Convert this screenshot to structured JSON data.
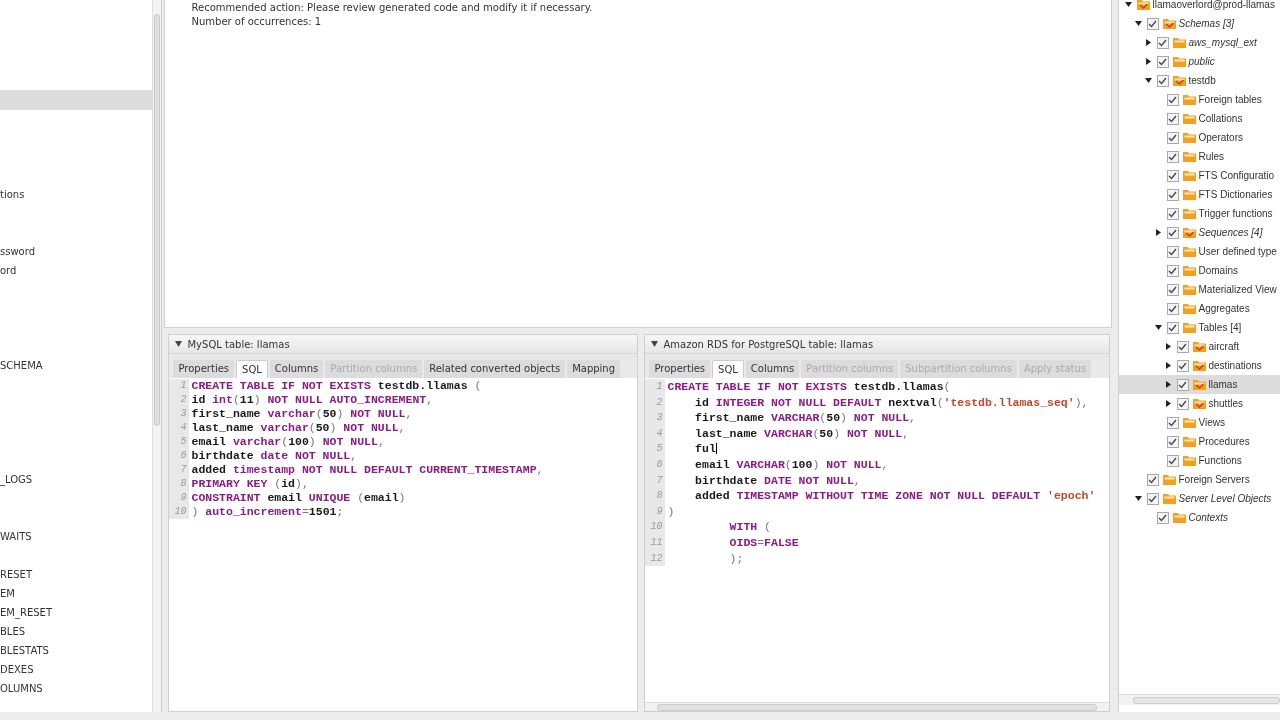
{
  "left_panel": {
    "items": [
      {
        "label": "tions"
      },
      {
        "label": "ssword"
      },
      {
        "label": "ord"
      },
      {
        "label": "SCHEMA"
      },
      {
        "label": "_LOGS"
      },
      {
        "label": "WAITS"
      },
      {
        "label": "RESET"
      },
      {
        "label": "EM"
      },
      {
        "label": "EM_RESET"
      },
      {
        "label": "BLES"
      },
      {
        "label": "BLESTATS"
      },
      {
        "label": "DEXES"
      },
      {
        "label": "OLUMNS"
      }
    ]
  },
  "message": {
    "lines": [
      "Recommended action: Please review generated code and modify it if necessary.",
      "Number of occurrences: 1"
    ]
  },
  "panes": [
    {
      "title": "MySQL table: llamas",
      "expanded": true,
      "tabs": [
        {
          "label": "Properties",
          "selected": false,
          "disabled": false
        },
        {
          "label": "SQL",
          "selected": true,
          "disabled": false
        },
        {
          "label": "Columns",
          "selected": false,
          "disabled": false
        },
        {
          "label": "Partition columns",
          "selected": false,
          "disabled": true
        },
        {
          "label": "Related converted objects",
          "selected": false,
          "disabled": false
        },
        {
          "label": "Mapping",
          "selected": false,
          "disabled": false
        }
      ],
      "lines": [
        {
          "num": "1",
          "caret": false,
          "tokens": [
            {
              "kind": "kw",
              "text": "CREATE TABLE IF NOT EXISTS "
            },
            {
              "kind": "id",
              "text": "testdb.llamas "
            },
            {
              "kind": "p",
              "text": "("
            }
          ]
        },
        {
          "num": "2",
          "caret": false,
          "tokens": [
            {
              "kind": "id",
              "text": "id "
            },
            {
              "kind": "kw",
              "text": "int"
            },
            {
              "kind": "p",
              "text": "("
            },
            {
              "kind": "id",
              "text": "11"
            },
            {
              "kind": "p",
              "text": ") "
            },
            {
              "kind": "kw",
              "text": "NOT NULL AUTO_INCREMENT"
            },
            {
              "kind": "p",
              "text": ","
            }
          ]
        },
        {
          "num": "3",
          "caret": false,
          "tokens": [
            {
              "kind": "id",
              "text": "first_name "
            },
            {
              "kind": "kw",
              "text": "varchar"
            },
            {
              "kind": "p",
              "text": "("
            },
            {
              "kind": "id",
              "text": "50"
            },
            {
              "kind": "p",
              "text": ") "
            },
            {
              "kind": "kw",
              "text": "NOT NULL"
            },
            {
              "kind": "p",
              "text": ","
            }
          ]
        },
        {
          "num": "4",
          "caret": false,
          "tokens": [
            {
              "kind": "id",
              "text": "last_name "
            },
            {
              "kind": "kw",
              "text": "varchar"
            },
            {
              "kind": "p",
              "text": "("
            },
            {
              "kind": "id",
              "text": "50"
            },
            {
              "kind": "p",
              "text": ") "
            },
            {
              "kind": "kw",
              "text": "NOT NULL"
            },
            {
              "kind": "p",
              "text": ","
            }
          ]
        },
        {
          "num": "5",
          "caret": false,
          "tokens": [
            {
              "kind": "id",
              "text": "email "
            },
            {
              "kind": "kw",
              "text": "varchar"
            },
            {
              "kind": "p",
              "text": "("
            },
            {
              "kind": "id",
              "text": "100"
            },
            {
              "kind": "p",
              "text": ") "
            },
            {
              "kind": "kw",
              "text": "NOT NULL"
            },
            {
              "kind": "p",
              "text": ","
            }
          ]
        },
        {
          "num": "6",
          "caret": false,
          "tokens": [
            {
              "kind": "id",
              "text": "birthdate "
            },
            {
              "kind": "kw",
              "text": "date NOT NULL"
            },
            {
              "kind": "p",
              "text": ","
            }
          ]
        },
        {
          "num": "7",
          "caret": false,
          "tokens": [
            {
              "kind": "id",
              "text": "added "
            },
            {
              "kind": "kw",
              "text": "timestamp NOT NULL DEFAULT CURRENT_TIMESTAMP"
            },
            {
              "kind": "p",
              "text": ","
            }
          ]
        },
        {
          "num": "8",
          "caret": false,
          "tokens": [
            {
              "kind": "kw",
              "text": "PRIMARY KEY "
            },
            {
              "kind": "p",
              "text": "("
            },
            {
              "kind": "id",
              "text": "id"
            },
            {
              "kind": "p",
              "text": "),"
            }
          ]
        },
        {
          "num": "9",
          "caret": false,
          "tokens": [
            {
              "kind": "kw",
              "text": "CONSTRAINT "
            },
            {
              "kind": "id",
              "text": "email "
            },
            {
              "kind": "kw",
              "text": "UNIQUE "
            },
            {
              "kind": "p",
              "text": "("
            },
            {
              "kind": "id",
              "text": "email"
            },
            {
              "kind": "p",
              "text": ")"
            }
          ]
        },
        {
          "num": "10",
          "caret": false,
          "tokens": [
            {
              "kind": "p",
              "text": ") "
            },
            {
              "kind": "kw",
              "text": "auto_increment"
            },
            {
              "kind": "p",
              "text": "="
            },
            {
              "kind": "id",
              "text": "1501"
            },
            {
              "kind": "p",
              "text": ";"
            }
          ]
        }
      ]
    },
    {
      "title": "Amazon RDS for PostgreSQL table: llamas",
      "expanded": true,
      "tabs": [
        {
          "label": "Properties",
          "selected": false,
          "disabled": false
        },
        {
          "label": "SQL",
          "selected": true,
          "disabled": false
        },
        {
          "label": "Columns",
          "selected": false,
          "disabled": false
        },
        {
          "label": "Partition columns",
          "selected": false,
          "disabled": true
        },
        {
          "label": "Subpartition columns",
          "selected": false,
          "disabled": true
        },
        {
          "label": "Apply status",
          "selected": false,
          "disabled": true
        }
      ],
      "lines": [
        {
          "num": "1",
          "caret": false,
          "tokens": [
            {
              "kind": "kw",
              "text": "CREATE TABLE IF NOT EXISTS "
            },
            {
              "kind": "id",
              "text": "testdb.llamas"
            },
            {
              "kind": "p",
              "text": "("
            }
          ]
        },
        {
          "num": "2",
          "caret": false,
          "tokens": [
            {
              "kind": "id",
              "text": "    id "
            },
            {
              "kind": "kw",
              "text": "INTEGER NOT NULL DEFAULT "
            },
            {
              "kind": "id",
              "text": "nextval"
            },
            {
              "kind": "p",
              "text": "("
            },
            {
              "kind": "str",
              "text": "'testdb.llamas_seq'"
            },
            {
              "kind": "p",
              "text": "),"
            }
          ]
        },
        {
          "num": "3",
          "caret": false,
          "tokens": [
            {
              "kind": "id",
              "text": "    first_name "
            },
            {
              "kind": "kw",
              "text": "VARCHAR"
            },
            {
              "kind": "p",
              "text": "("
            },
            {
              "kind": "id",
              "text": "50"
            },
            {
              "kind": "p",
              "text": ") "
            },
            {
              "kind": "kw",
              "text": "NOT NULL"
            },
            {
              "kind": "p",
              "text": ","
            }
          ]
        },
        {
          "num": "4",
          "caret": false,
          "tokens": [
            {
              "kind": "id",
              "text": "    last_name "
            },
            {
              "kind": "kw",
              "text": "VARCHAR"
            },
            {
              "kind": "p",
              "text": "("
            },
            {
              "kind": "id",
              "text": "50"
            },
            {
              "kind": "p",
              "text": ") "
            },
            {
              "kind": "kw",
              "text": "NOT NULL"
            },
            {
              "kind": "p",
              "text": ","
            }
          ]
        },
        {
          "num": "5",
          "caret": true,
          "tokens": [
            {
              "kind": "id",
              "text": "    ful"
            }
          ]
        },
        {
          "num": "6",
          "caret": false,
          "tokens": [
            {
              "kind": "id",
              "text": "    email "
            },
            {
              "kind": "kw",
              "text": "VARCHAR"
            },
            {
              "kind": "p",
              "text": "("
            },
            {
              "kind": "id",
              "text": "100"
            },
            {
              "kind": "p",
              "text": ") "
            },
            {
              "kind": "kw",
              "text": "NOT NULL"
            },
            {
              "kind": "p",
              "text": ","
            }
          ]
        },
        {
          "num": "7",
          "caret": false,
          "tokens": [
            {
              "kind": "id",
              "text": "    birthdate "
            },
            {
              "kind": "kw",
              "text": "DATE NOT NULL"
            },
            {
              "kind": "p",
              "text": ","
            }
          ]
        },
        {
          "num": "8",
          "caret": false,
          "tokens": [
            {
              "kind": "id",
              "text": "    added "
            },
            {
              "kind": "kw",
              "text": "TIMESTAMP WITHOUT TIME ZONE NOT NULL DEFAULT "
            },
            {
              "kind": "str",
              "text": "'epoch'"
            }
          ]
        },
        {
          "num": "9",
          "caret": false,
          "tokens": [
            {
              "kind": "p",
              "text": ")"
            }
          ]
        },
        {
          "num": "10",
          "caret": false,
          "tokens": [
            {
              "kind": "kw",
              "text": "         WITH "
            },
            {
              "kind": "p",
              "text": "("
            }
          ]
        },
        {
          "num": "11",
          "caret": false,
          "tokens": [
            {
              "kind": "kw",
              "text": "         OIDS"
            },
            {
              "kind": "p",
              "text": "="
            },
            {
              "kind": "kw",
              "text": "FALSE"
            }
          ]
        },
        {
          "num": "12",
          "caret": false,
          "tokens": [
            {
              "kind": "p",
              "text": "         );"
            }
          ]
        }
      ]
    }
  ],
  "tree": [
    {
      "label": "llamaoverlord@prod-llamas",
      "kind": "root",
      "expanded": true,
      "italic": false,
      "selected": false,
      "children": [
        {
          "label": "Schemas [3]",
          "kind": "object",
          "expanded": true,
          "checked": true,
          "italic": true,
          "selected": false,
          "children": [
            {
              "label": "aws_mysql_ext",
              "kind": "folder",
              "expanded": false,
              "checked": true,
              "italic": true,
              "selected": false
            },
            {
              "label": "public",
              "kind": "folder",
              "expanded": false,
              "checked": true,
              "italic": true,
              "selected": false
            },
            {
              "label": "testdb",
              "kind": "object",
              "expanded": true,
              "checked": true,
              "italic": false,
              "selected": false,
              "children": [
                {
                  "label": "Foreign tables",
                  "kind": "folder",
                  "checked": true,
                  "italic": false,
                  "selected": false
                },
                {
                  "label": "Collations",
                  "kind": "folder",
                  "checked": true,
                  "italic": false,
                  "selected": false
                },
                {
                  "label": "Operators",
                  "kind": "folder",
                  "checked": true,
                  "italic": false,
                  "selected": false
                },
                {
                  "label": "Rules",
                  "kind": "folder",
                  "checked": true,
                  "italic": false,
                  "selected": false
                },
                {
                  "label": "FTS Configuratio",
                  "kind": "folder",
                  "checked": true,
                  "italic": false,
                  "selected": false
                },
                {
                  "label": "FTS Dictionaries",
                  "kind": "folder",
                  "checked": true,
                  "italic": false,
                  "selected": false
                },
                {
                  "label": "Trigger functions",
                  "kind": "folder",
                  "checked": true,
                  "italic": false,
                  "selected": false
                },
                {
                  "label": "Sequences [4]",
                  "kind": "object",
                  "expanded": false,
                  "checked": true,
                  "italic": true,
                  "selected": false
                },
                {
                  "label": "User defined type",
                  "kind": "folder",
                  "checked": true,
                  "italic": false,
                  "selected": false
                },
                {
                  "label": "Domains",
                  "kind": "folder",
                  "checked": true,
                  "italic": false,
                  "selected": false
                },
                {
                  "label": "Materialized View",
                  "kind": "folder",
                  "checked": true,
                  "italic": false,
                  "selected": false
                },
                {
                  "label": "Aggregates",
                  "kind": "folder",
                  "checked": true,
                  "italic": false,
                  "selected": false
                },
                {
                  "label": "Tables [4]",
                  "kind": "folder",
                  "expanded": true,
                  "checked": true,
                  "italic": false,
                  "selected": false,
                  "children": [
                    {
                      "label": "aircraft",
                      "kind": "object",
                      "expanded": false,
                      "checked": true,
                      "italic": false,
                      "selected": false
                    },
                    {
                      "label": "destinations",
                      "kind": "object",
                      "expanded": false,
                      "checked": true,
                      "italic": false,
                      "selected": false
                    },
                    {
                      "label": "llamas",
                      "kind": "object",
                      "expanded": false,
                      "checked": true,
                      "italic": false,
                      "selected": true
                    },
                    {
                      "label": "shuttles",
                      "kind": "object",
                      "expanded": false,
                      "checked": true,
                      "italic": false,
                      "selected": false
                    }
                  ]
                },
                {
                  "label": "Views",
                  "kind": "folder",
                  "checked": true,
                  "italic": false,
                  "selected": false
                },
                {
                  "label": "Procedures",
                  "kind": "folder",
                  "checked": true,
                  "italic": false,
                  "selected": false
                },
                {
                  "label": "Functions",
                  "kind": "folder",
                  "checked": true,
                  "italic": false,
                  "selected": false
                }
              ]
            }
          ]
        },
        {
          "label": "Foreign Servers",
          "kind": "folder",
          "checked": true,
          "italic": false,
          "selected": false
        },
        {
          "label": "Server Level Objects",
          "kind": "folder",
          "expanded": true,
          "checked": true,
          "italic": true,
          "selected": false,
          "children": [
            {
              "label": "Contexts",
              "kind": "folder",
              "checked": true,
              "italic": true,
              "selected": false
            }
          ]
        }
      ]
    }
  ]
}
